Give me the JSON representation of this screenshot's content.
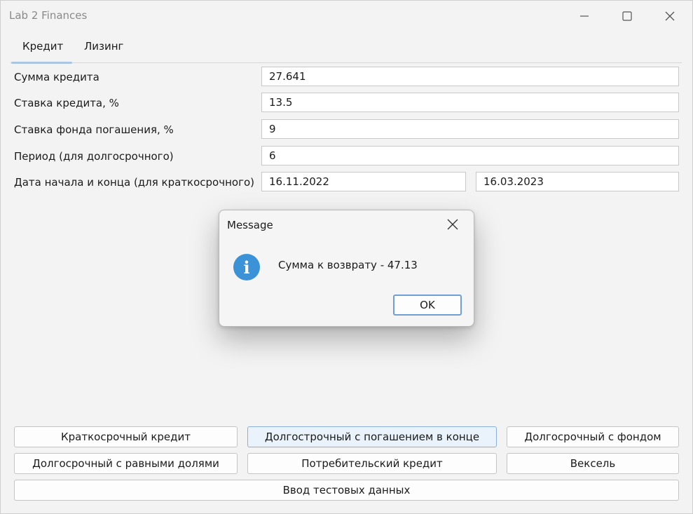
{
  "window": {
    "title": "Lab 2 Finances"
  },
  "tabs": [
    {
      "label": "Кредит",
      "active": true
    },
    {
      "label": "Лизинг",
      "active": false
    }
  ],
  "form": {
    "loan_amount": {
      "label": "Сумма кредита",
      "value": "27.641"
    },
    "loan_rate": {
      "label": "Ставка кредита, %",
      "value": "13.5"
    },
    "fund_rate": {
      "label": "Ставка фонда погашения, %",
      "value": "9"
    },
    "period": {
      "label": "Период (для долгосрочного)",
      "value": "6"
    },
    "dates": {
      "label": "Дата начала и конца (для краткосрочного)",
      "start": "16.11.2022",
      "end": "16.03.2023"
    }
  },
  "buttons": {
    "short_term": "Краткосрочный кредит",
    "long_term_end": "Долгострочный с погашением в конце",
    "long_term_fund": "Долгосрочный с фондом",
    "long_term_equal": "Долгосрочный с равными долями",
    "consumer": "Потребительский кредит",
    "bill": "Вексель",
    "test_data": "Ввод тестовых данных"
  },
  "dialog": {
    "title": "Message",
    "message": "Сумма к возврату - 47.13",
    "ok": "OK",
    "icon": "info-icon",
    "icon_color": "#3b92d6"
  }
}
